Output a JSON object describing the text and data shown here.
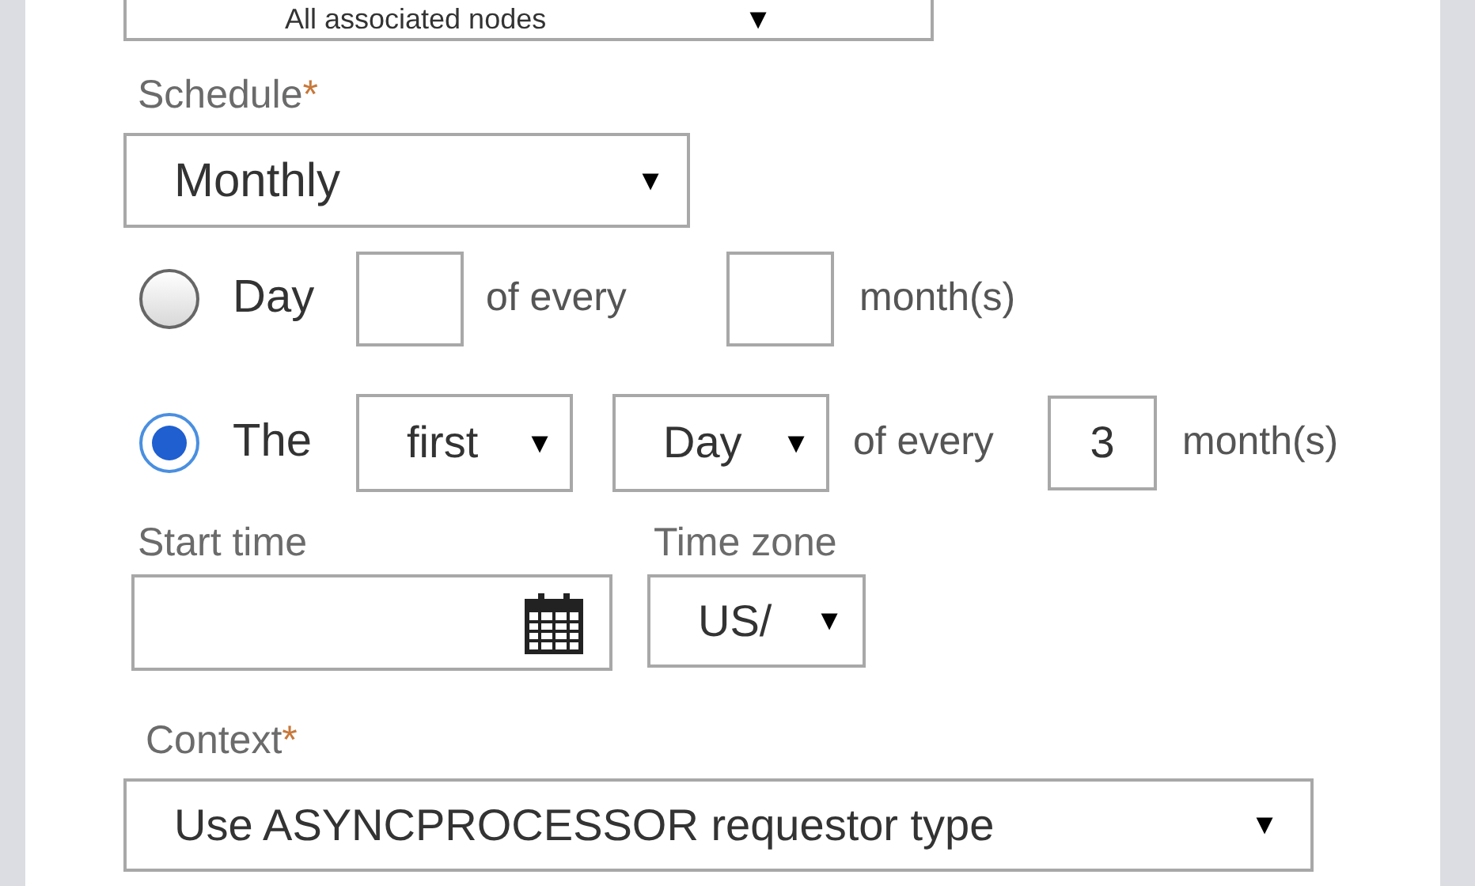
{
  "top_dropdown": {
    "value": "All associated nodes"
  },
  "schedule": {
    "label": "Schedule",
    "required_mark": "*",
    "value": "Monthly",
    "caret": "▼"
  },
  "options": [
    {
      "kind": "day",
      "selected": false,
      "label": "Day",
      "text_1": "of every",
      "text_2": "month(s)"
    },
    {
      "kind": "ordinal",
      "selected": true,
      "label": "The",
      "ordinal": "first",
      "weekday": "Day",
      "text_1": "of every",
      "months": "3",
      "text_2": "month(s)"
    }
  ],
  "start_time": {
    "label": "Start time"
  },
  "time_zone": {
    "label": "Time zone",
    "value": "US/"
  },
  "context": {
    "label": "Context",
    "required_mark": "*",
    "value": "Use ASYNCPROCESSOR requestor type"
  }
}
